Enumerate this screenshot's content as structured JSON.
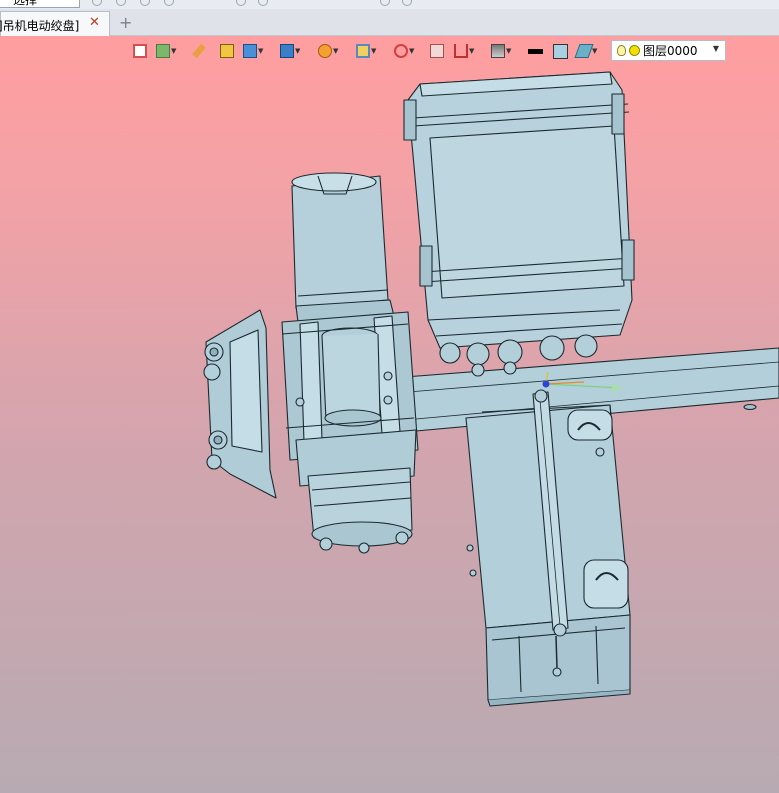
{
  "top": {
    "selector_value": "一选择"
  },
  "tabs": [
    {
      "label": "]吊机电动绞盘]",
      "close": "✕"
    }
  ],
  "new_tab": "+",
  "layer": {
    "name": "图层0000",
    "caret": "▼"
  },
  "colors": {
    "viewport_top": "#ff9ea0",
    "viewport_bottom": "#b8aab2",
    "part_fill": "#b3cfda",
    "edge": "#1c2a30"
  }
}
